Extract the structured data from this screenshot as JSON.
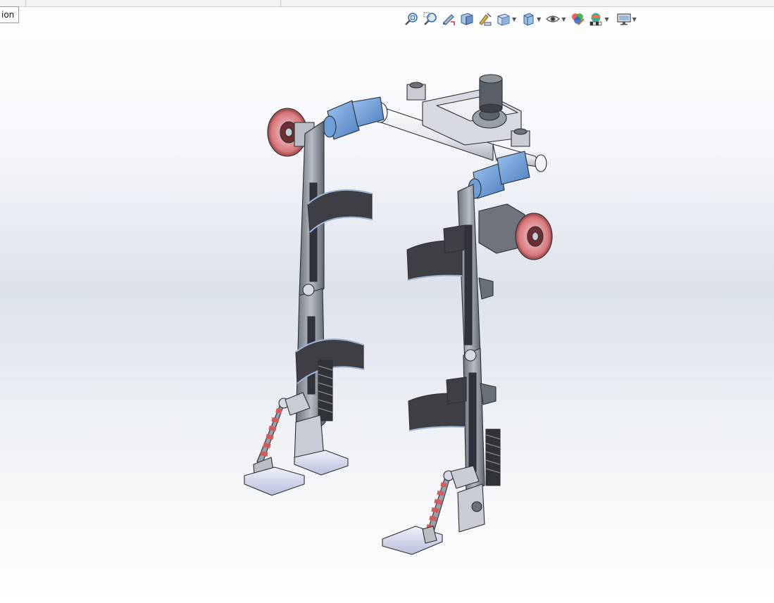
{
  "window": {
    "tab_label": "ion"
  },
  "heads_up_toolbar": {
    "buttons": [
      {
        "name": "zoom-to-fit",
        "icon": "zoom-fit-icon",
        "dropdown": false
      },
      {
        "name": "zoom-to-area",
        "icon": "zoom-area-icon",
        "dropdown": false
      },
      {
        "name": "previous-view",
        "icon": "previous-view-icon",
        "dropdown": false
      },
      {
        "name": "section-view",
        "icon": "section-view-icon",
        "dropdown": false
      },
      {
        "name": "dynamic-annotation-views",
        "icon": "annotation-views-icon",
        "dropdown": false
      },
      {
        "name": "view-orientation",
        "icon": "view-orientation-icon",
        "dropdown": true
      },
      {
        "name": "display-style",
        "icon": "display-style-icon",
        "dropdown": true
      },
      {
        "name": "hide-show-items",
        "icon": "eye-icon",
        "dropdown": true
      },
      {
        "name": "edit-appearance",
        "icon": "appearance-icon",
        "dropdown": false
      },
      {
        "name": "apply-scene",
        "icon": "scene-icon",
        "dropdown": true
      },
      {
        "name": "view-settings",
        "icon": "monitor-icon",
        "dropdown": true
      }
    ]
  },
  "colors": {
    "steel": "#8e949c",
    "steel_dark": "#4f555c",
    "blue_part": "#6f9fd8",
    "white_part": "#eceef2",
    "wheel": "#d97a7e",
    "spring": "#d25c5c",
    "strap": "#3d3f45",
    "foot": "#d9ddf0"
  }
}
